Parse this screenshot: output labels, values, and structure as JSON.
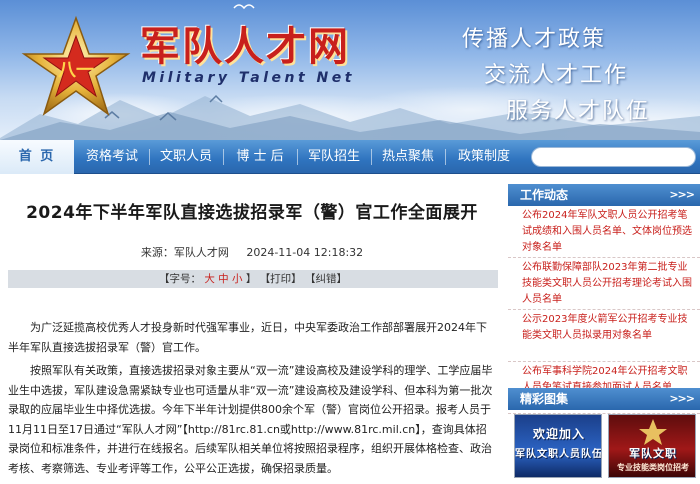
{
  "banner": {
    "title": "军队人才网",
    "subtitle": "Military Talent Net",
    "slogans": [
      "传播人才政策",
      "交流人才工作",
      "服务人才队伍"
    ]
  },
  "nav": {
    "items": [
      "首 页",
      "资格考试",
      "文职人员",
      "博 士 后",
      "军队招生",
      "热点聚焦",
      "政策制度"
    ],
    "active_index": 0,
    "search_value": ""
  },
  "article": {
    "title": "2024年下半年军队直接选拔招录军（警）官工作全面展开",
    "source_label": "来源：军队人才网",
    "datetime": "2024-11-04 12:18:32",
    "tools": {
      "font_size_prefix": "【字号：",
      "font_large": "大",
      "font_medium": "中",
      "font_small": "小",
      "font_size_suffix": "】",
      "print": "【打印】",
      "correct": "【纠错】"
    },
    "paragraphs": [
      "为广泛延揽高校优秀人才投身新时代强军事业，近日，中央军委政治工作部部署展开2024年下半年军队直接选拔招录军（警）官工作。",
      "按照军队有关政策，直接选拔招录对象主要从“双一流”建设高校及建设学科的理学、工学应届毕业生中选拔，军队建设急需紧缺专业也可适量从非“双一流”建设高校及建设学科、但本科为第一批次录取的应届毕业生中择优选拔。今年下半年计划提供800余个军（警）官岗位公开招录。报考人员于11月11日至17日通过“军队人才网”【http://81rc.81.cn或http://www.81rc.mil.cn】，查询具体招录岗位和标准条件，并进行在线报名。后续军队相关单位将按照招录程序，组织开展体格检查、政治考核、考察筛选、专业考评等工作，公平公正选拔，确保招录质量。"
    ]
  },
  "sidebar": {
    "work_news": {
      "title": "工作动态",
      "more": ">>>",
      "items": [
        "公布2024年军队文职人员公开招考笔试成绩和入围人员名单、文体岗位预选对象名单",
        "公布联勤保障部队2023年第二批专业技能类文职人员公开招考理论考试入围人员名单",
        "公示2023年度火箭军公开招考专业技能类文职人员拟录用对象名单",
        "公布军事科学院2024年公开招考文职人员免笔试直接参加面试人员名单"
      ]
    },
    "gallery": {
      "title": "精彩图集",
      "more": ">>>",
      "item1_caption_line1": "欢迎加入",
      "item1_caption_line2": "军队文职人员队伍",
      "item2_caption_line1": "军队文职",
      "item2_caption_line2": "专业技能类岗位招考"
    }
  },
  "colors": {
    "brand_red": "#c8201c",
    "nav_blue": "#2f74bf",
    "sidebar_link_red": "#c8201c"
  }
}
